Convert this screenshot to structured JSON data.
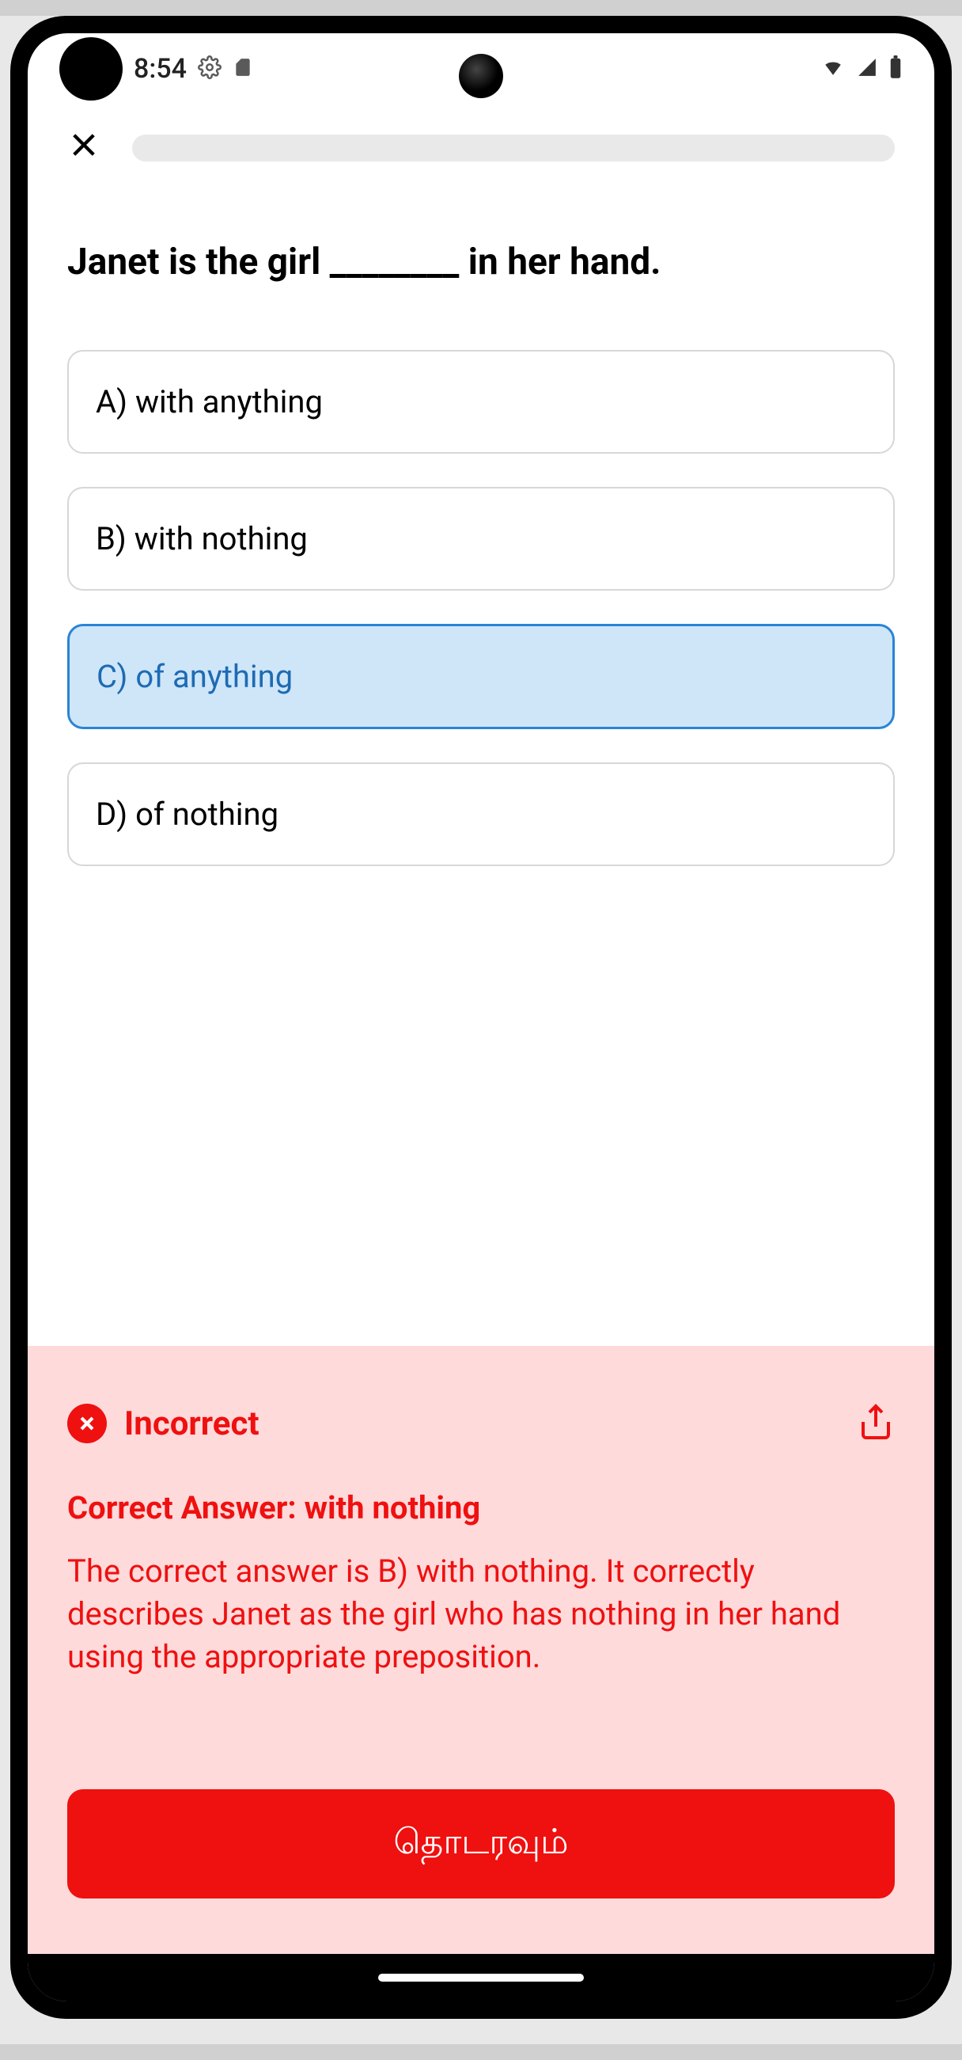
{
  "status": {
    "time": "8:54"
  },
  "question": "Janet is the girl ________ in her hand.",
  "options": {
    "a": "A) with anything",
    "b": "B) with nothing",
    "c": "C) of anything",
    "d": "D) of nothing"
  },
  "feedback": {
    "status": "Incorrect",
    "correct_label": "Correct Answer: with nothing",
    "explanation": "The correct answer is B) with nothing. It correctly describes Janet as the girl who has nothing in her hand using the appropriate preposition.",
    "continue_label": "தொடரவும்"
  }
}
